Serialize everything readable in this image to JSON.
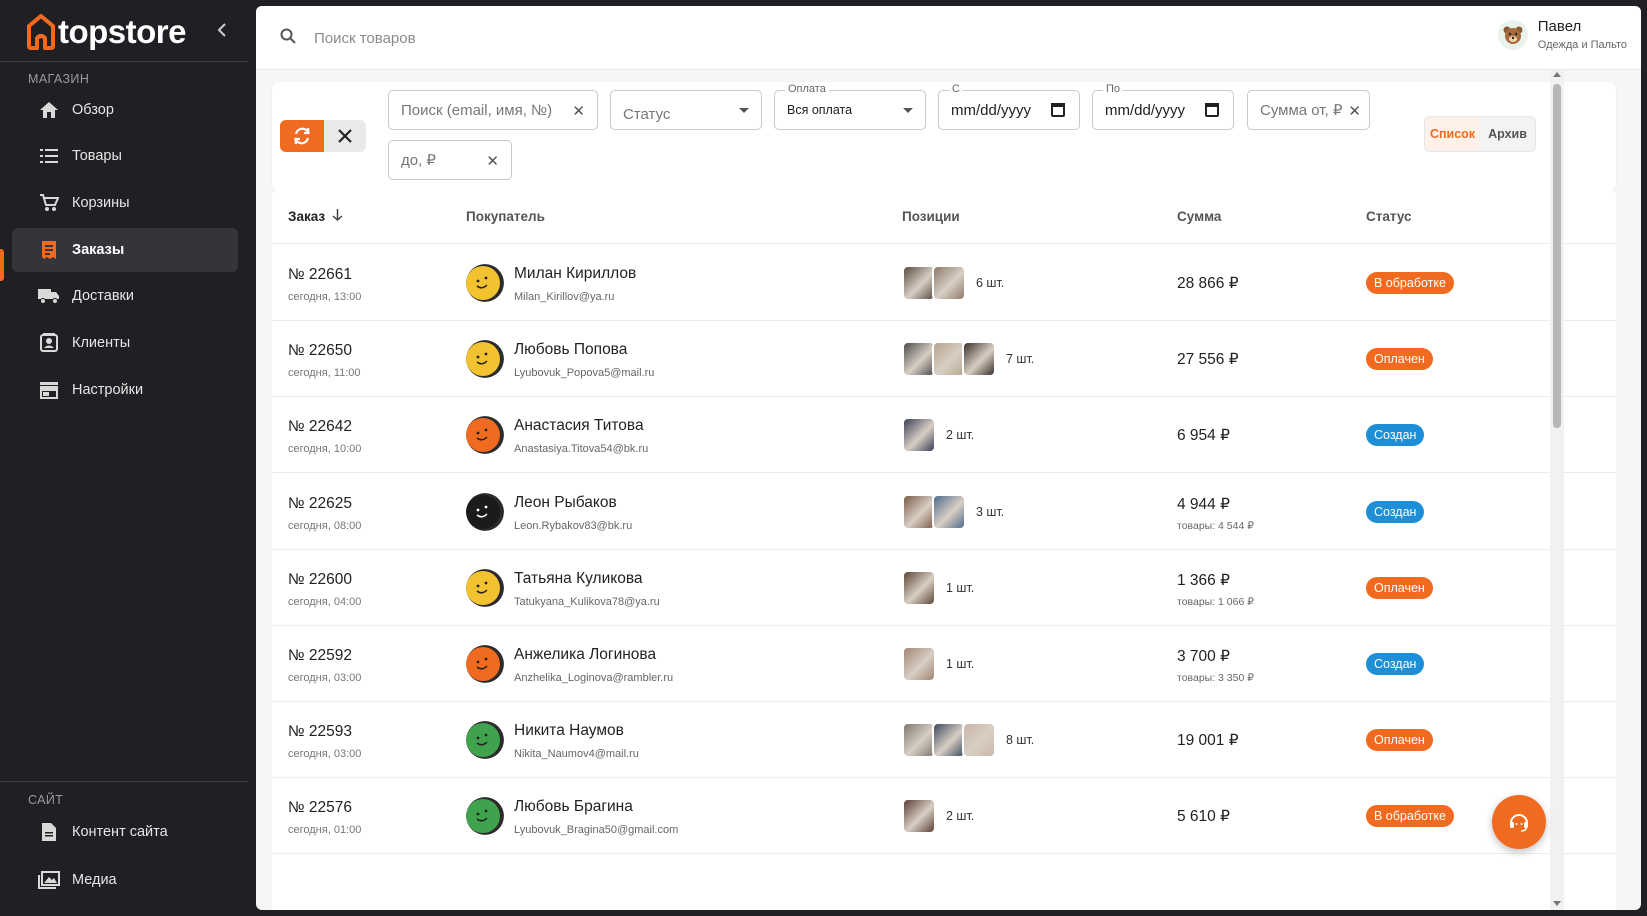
{
  "brand": {
    "name": "topstore",
    "accent": "#f06a1f",
    "info": "#1e8fd6"
  },
  "sidebar": {
    "shop_section": "МАГАЗИН",
    "items": [
      {
        "label": "Обзор",
        "icon": "home-icon"
      },
      {
        "label": "Товары",
        "icon": "list-icon"
      },
      {
        "label": "Корзины",
        "icon": "cart-icon"
      },
      {
        "label": "Заказы",
        "icon": "receipt-icon",
        "active": true
      },
      {
        "label": "Доставки",
        "icon": "truck-icon"
      },
      {
        "label": "Клиенты",
        "icon": "contacts-icon"
      },
      {
        "label": "Настройки",
        "icon": "store-icon"
      }
    ],
    "site_section": "САЙТ",
    "site_items": [
      {
        "label": "Контент сайта",
        "icon": "document-icon"
      },
      {
        "label": "Медиа",
        "icon": "photo-library-icon"
      }
    ]
  },
  "topbar": {
    "search_placeholder": "Поиск товаров",
    "user_name": "Павел",
    "user_role": "Одежда и Пальто"
  },
  "filters": {
    "search_placeholder": "Поиск (email, имя, №)",
    "status_placeholder": "Статус",
    "payment_legend": "Оплата",
    "payment_value": "Вся оплата",
    "from_legend": "С",
    "from_value": "mm/dd/yyyy",
    "to_legend": "По",
    "to_value": "mm/dd/yyyy",
    "sum_from_placeholder": "Сумма от, ₽",
    "sum_to_placeholder": "до, ₽",
    "view_list": "Список",
    "view_archive": "Архив"
  },
  "table": {
    "columns": [
      "Заказ",
      "Покупатель",
      "Позиции",
      "Сумма",
      "Статус"
    ],
    "rows": [
      {
        "order": "№ 22661",
        "time": "сегодня, 13:00",
        "name": "Милан Кириллов",
        "email": "Milan_Kirillov@ya.ru",
        "avatar": "#f2c230",
        "thumbs": [
          "#5a4a3e",
          "#8c7a6a"
        ],
        "qty": "6 шт.",
        "sum": "28 866 ₽",
        "sum_sub": "",
        "status": "В обработке",
        "status_type": "processing"
      },
      {
        "order": "№ 22650",
        "time": "сегодня, 11:00",
        "name": "Любовь Попова",
        "email": "Lyubovuk_Popova5@mail.ru",
        "avatar": "#f2c230",
        "thumbs": [
          "#4b4b4b",
          "#b5a58f",
          "#3b2f2a"
        ],
        "qty": "7 шт.",
        "sum": "27 556 ₽",
        "sum_sub": "",
        "status": "Оплачен",
        "status_type": "paid"
      },
      {
        "order": "№ 22642",
        "time": "сегодня, 10:00",
        "name": "Анастасия Титова",
        "email": "Anastasiya.Titova54@bk.ru",
        "avatar": "#f06a1f",
        "thumbs": [
          "#3a3f55"
        ],
        "qty": "2 шт.",
        "sum": "6 954 ₽",
        "sum_sub": "",
        "status": "Создан",
        "status_type": "created"
      },
      {
        "order": "№ 22625",
        "time": "сегодня, 08:00",
        "name": "Леон Рыбаков",
        "email": "Leon.Rybakov83@bk.ru",
        "avatar": "#1b1b1b",
        "thumbs": [
          "#7a5a48",
          "#4f6a8a"
        ],
        "qty": "3 шт.",
        "sum": "4 944 ₽",
        "sum_sub": "товары: 4 544 ₽",
        "status": "Создан",
        "status_type": "created"
      },
      {
        "order": "№ 22600",
        "time": "сегодня, 04:00",
        "name": "Татьяна Куликова",
        "email": "Tatukyana_Kulikova78@ya.ru",
        "avatar": "#f2c230",
        "thumbs": [
          "#5b4636"
        ],
        "qty": "1 шт.",
        "sum": "1 366 ₽",
        "sum_sub": "товары: 1 066 ₽",
        "status": "Оплачен",
        "status_type": "paid"
      },
      {
        "order": "№ 22592",
        "time": "сегодня, 03:00",
        "name": "Анжелика Логинова",
        "email": "Anzhelika_Loginova@rambler.ru",
        "avatar": "#f06a1f",
        "thumbs": [
          "#a08474"
        ],
        "qty": "1 шт.",
        "sum": "3 700 ₽",
        "sum_sub": "товары: 3 350 ₽",
        "status": "Создан",
        "status_type": "created"
      },
      {
        "order": "№ 22593",
        "time": "сегодня, 03:00",
        "name": "Никита Наумов",
        "email": "Nikita_Naumov4@mail.ru",
        "avatar": "#3fa34d",
        "thumbs": [
          "#7d7870",
          "#3c4a5c",
          "#c9b7a6"
        ],
        "qty": "8 шт.",
        "sum": "19 001 ₽",
        "sum_sub": "",
        "status": "Оплачен",
        "status_type": "paid"
      },
      {
        "order": "№ 22576",
        "time": "сегодня, 01:00",
        "name": "Любовь Брагина",
        "email": "Lyubovuk_Bragina50@gmail.com",
        "avatar": "#3fa34d",
        "thumbs": [
          "#5a3e36"
        ],
        "qty": "2 шт.",
        "sum": "5 610 ₽",
        "sum_sub": "",
        "status": "В обработке",
        "status_type": "processing"
      }
    ]
  }
}
